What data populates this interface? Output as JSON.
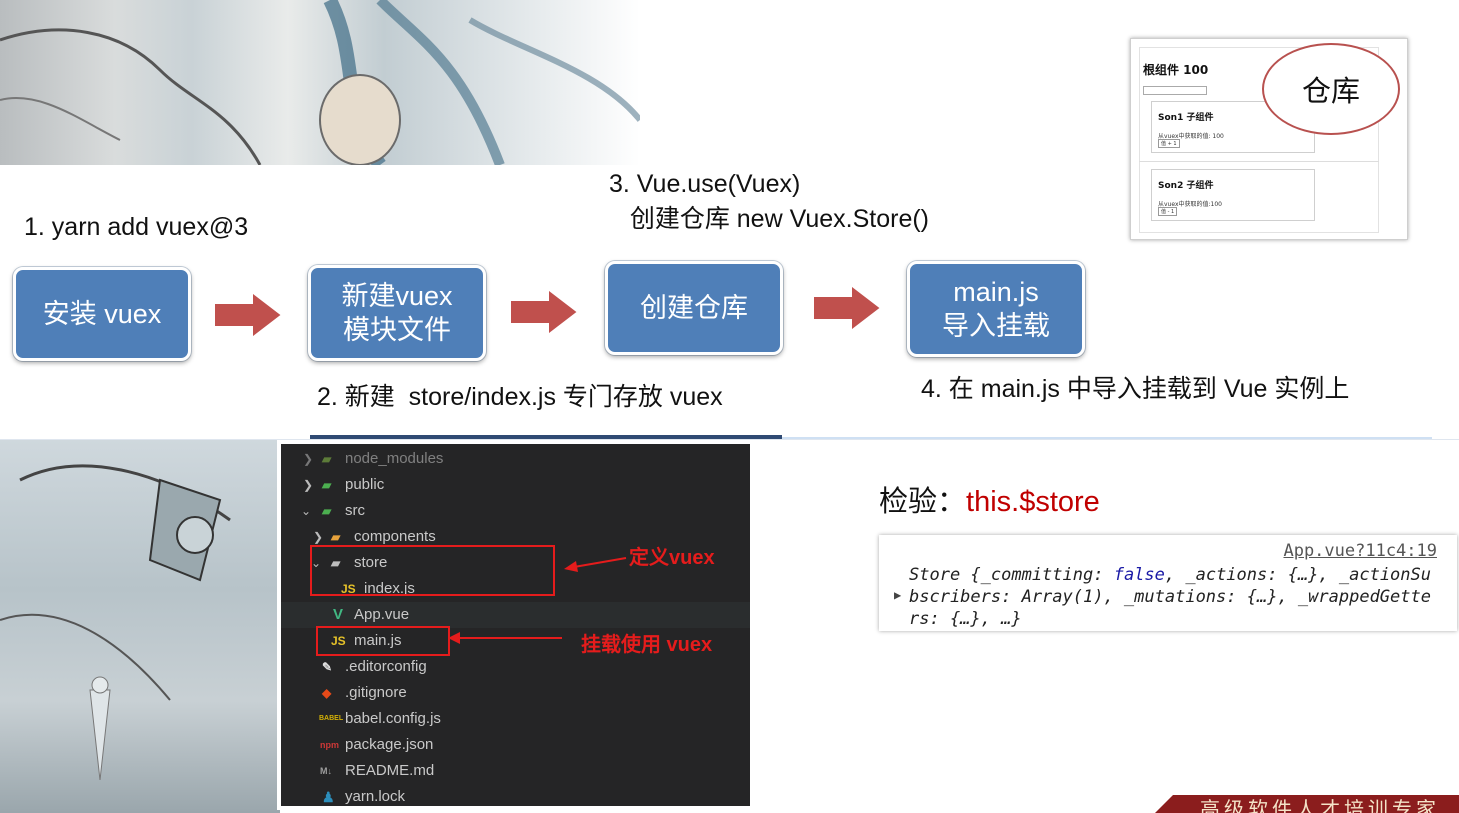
{
  "steps": {
    "step1_text": "1. yarn add vuex@3",
    "step2_text": "2. 新建  store/index.js 专门存放 vuex",
    "step3_text": "3. Vue.use(Vuex)\n   创建仓库 new Vuex.Store()",
    "step4_text": "4. 在 main.js 中导入挂载到 Vue 实例上",
    "box1": "安装 vuex",
    "box2": "新建vuex\n模块文件",
    "box3": "创建仓库",
    "box4": "main.js\n导入挂载"
  },
  "store_preview": {
    "root_title": "根组件 100",
    "son1_title": "Son1 子组件",
    "son1_text": "从vuex中获取的值: 100",
    "son1_button": "值 + 1",
    "son2_title": "Son2 子组件",
    "son2_text": "从vuex中获取的值:100",
    "son2_button": "值 - 1",
    "warehouse_label": "仓库"
  },
  "explorer": {
    "rows": [
      {
        "label": "node_modules",
        "icon": "folder-icon"
      },
      {
        "label": "public",
        "icon": "folder-icon"
      },
      {
        "label": "src",
        "icon": "folder-icon"
      },
      {
        "label": "components",
        "icon": "folder-icon"
      },
      {
        "label": "store",
        "icon": "folder-icon"
      },
      {
        "label": "index.js",
        "icon": "js-file-icon",
        "badge": "JS"
      },
      {
        "label": "App.vue",
        "icon": "vue-file-icon",
        "badge": "V"
      },
      {
        "label": "main.js",
        "icon": "js-file-icon",
        "badge": "JS"
      },
      {
        "label": ".editorconfig",
        "icon": "editorconfig-icon"
      },
      {
        "label": ".gitignore",
        "icon": "git-icon"
      },
      {
        "label": "babel.config.js",
        "icon": "babel-icon",
        "badge": "BABEL"
      },
      {
        "label": "package.json",
        "icon": "npm-icon",
        "badge": "npm"
      },
      {
        "label": "README.md",
        "icon": "markdown-icon",
        "badge": "M↓"
      },
      {
        "label": "yarn.lock",
        "icon": "yarn-icon"
      }
    ],
    "note_define": "定义vuex",
    "note_mount": "挂载使用 vuex"
  },
  "verify": {
    "label": "检验：",
    "code": "this.$store",
    "console_source": "App.vue?11c4:19",
    "console_line1_a": "Store {_committing: ",
    "console_line1_kw": "false",
    "console_line1_b": ", _actions: {…}, _actionSu",
    "console_line2": "bscribers: Array(1), _mutations: {…}, _wrappedGette",
    "console_line3": "rs: {…}, …}"
  },
  "footer": {
    "text": "高级软件人才培训专家"
  },
  "colors": {
    "step_box": "#4f7fb8",
    "arrow": "#c0504d",
    "red_note": "#e51c1c",
    "verify_red": "#c00000",
    "explorer_bg": "#252526"
  }
}
